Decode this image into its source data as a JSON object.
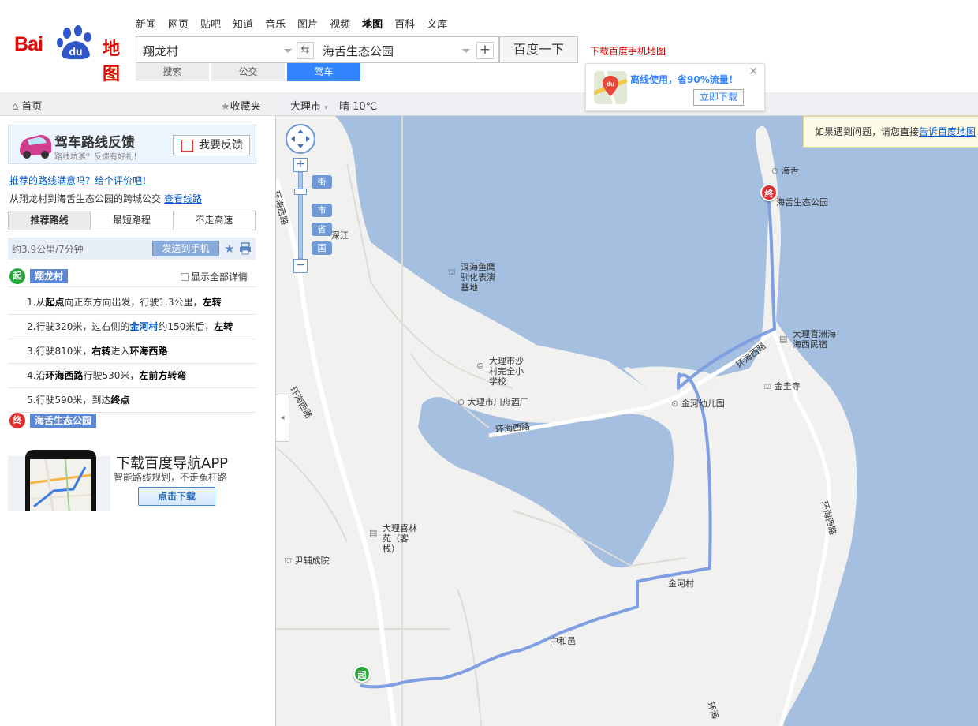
{
  "header": {
    "nav": [
      "新闻",
      "网页",
      "贴吧",
      "知道",
      "音乐",
      "图片",
      "视频",
      "地图",
      "百科",
      "文库"
    ],
    "nav_active": "地图",
    "logo_text_left": "Bai",
    "logo_text_du": "du",
    "logo_text_right": "地图",
    "search": {
      "from": "翔龙村",
      "to": "海舌生态公园",
      "button": "百度一下"
    },
    "modes": [
      "搜索",
      "公交",
      "驾车"
    ],
    "mode_active": "驾车",
    "mobile_link": "下载百度手机地图",
    "promo": {
      "message": "离线使用，省90%流量！",
      "download": "立即下载"
    }
  },
  "toolbar": {
    "home": "首页",
    "favorites": "收藏夹",
    "city": "大理市",
    "weather": "晴 10℃"
  },
  "sidebar": {
    "feedback": {
      "title": "驾车路线反馈",
      "subtitle": "路线坑爹？反馈有好礼！",
      "button": "我要反馈"
    },
    "rate_link": "推荐的路线满意吗？给个评价吧！",
    "route_desc": "从翔龙村到海舌生态公园的跨城公交",
    "view_route": "查看线路",
    "tabs": [
      "推荐路线",
      "最短路程",
      "不走高速"
    ],
    "tab_active": "推荐路线",
    "summary": "约3.9公里/7分钟",
    "send_to_phone": "发送到手机",
    "start_marker": "起",
    "start_name": "翔龙村",
    "show_all": "显示全部详情",
    "steps": [
      {
        "n": "1.",
        "parts": [
          [
            "t",
            "从"
          ],
          [
            "b",
            "起点"
          ],
          [
            "t",
            "向正东方向出发，行驶1.3公里，"
          ],
          [
            "b",
            "左转"
          ]
        ]
      },
      {
        "n": "2.",
        "parts": [
          [
            "t",
            "行驶320米，过右侧的"
          ],
          [
            "l",
            "金河村"
          ],
          [
            "t",
            "约150米后，"
          ],
          [
            "b",
            "左转"
          ]
        ]
      },
      {
        "n": "3.",
        "parts": [
          [
            "t",
            "行驶810米，"
          ],
          [
            "b",
            "右转"
          ],
          [
            "t",
            "进入"
          ],
          [
            "b",
            "环海西路"
          ]
        ]
      },
      {
        "n": "4.",
        "parts": [
          [
            "t",
            "沿"
          ],
          [
            "b",
            "环海西路"
          ],
          [
            "t",
            "行驶530米，"
          ],
          [
            "b",
            "左前方转弯"
          ]
        ]
      },
      {
        "n": "5.",
        "parts": [
          [
            "t",
            "行驶590米，到达"
          ],
          [
            "b",
            "终点"
          ]
        ]
      }
    ],
    "end_marker": "终",
    "end_name": "海舌生态公园",
    "app_ad": {
      "title": "下载百度导航APP",
      "subtitle": "智能路线规划，不走冤枉路",
      "button": "点击下载"
    }
  },
  "map": {
    "report_text": "如果遇到问题，请您直接",
    "report_link": "告诉百度地图",
    "zoom_labels": [
      "街",
      "市",
      "省",
      "国"
    ],
    "pois": {
      "haishe": "海舌",
      "haishe_park": "海舌生态公园",
      "shenjiang": "深江",
      "eagle": "洱海鱼鹰驯化表演基地",
      "shacun": "大理市沙村完全小学校",
      "chuanzhou": "大理市川舟酒厂",
      "jinhe_kg": "金河幼儿园",
      "xizhou": "大理喜洲海海西民宿",
      "jingui": "金圭寺",
      "xilinyuan": "大理喜林苑（客栈）",
      "yinfu": "尹辅成院",
      "jinhecun": "金河村",
      "zhonghe": "中和邑"
    },
    "roads": {
      "huanhai1": "环海西路",
      "huanhai2": "环海西路",
      "huanhai3": "环海西路",
      "huanhai4": "环海西路",
      "huanhai5": "环海西路",
      "huanhai6": "环海"
    },
    "start_marker": "起",
    "end_marker": "终",
    "colors": {
      "water": "#a5bfe0",
      "land": "#f1f1ef",
      "route": "#7e9fe1"
    }
  }
}
